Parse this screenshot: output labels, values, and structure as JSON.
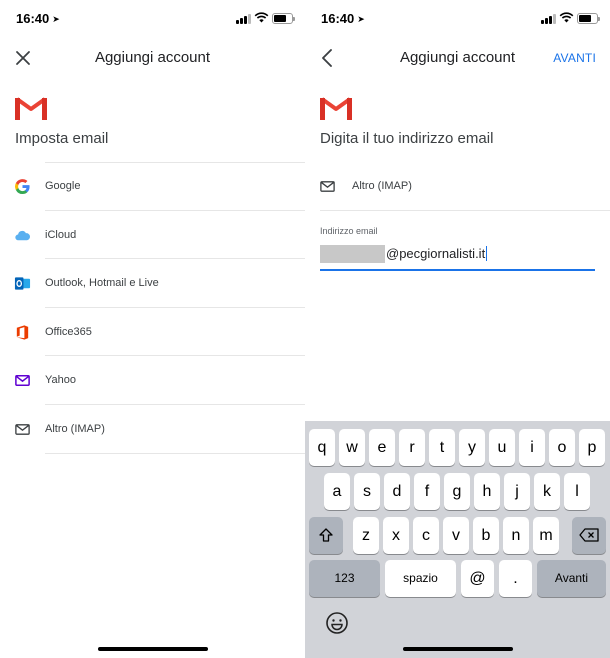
{
  "status_bar": {
    "time": "16:40"
  },
  "left": {
    "header_title": "Aggiungi account",
    "heading": "Imposta email",
    "providers": [
      {
        "label": "Google",
        "icon": "google-icon"
      },
      {
        "label": "iCloud",
        "icon": "icloud-icon"
      },
      {
        "label": "Outlook, Hotmail e Live",
        "icon": "outlook-icon"
      },
      {
        "label": "Office365",
        "icon": "office365-icon"
      },
      {
        "label": "Yahoo",
        "icon": "yahoo-icon"
      },
      {
        "label": "Altro (IMAP)",
        "icon": "mail-icon"
      }
    ]
  },
  "right": {
    "header_title": "Aggiungi account",
    "next_label": "AVANTI",
    "heading": "Digita il tuo indirizzo email",
    "selected_provider": "Altro (IMAP)",
    "field_label": "Indirizzo email",
    "field_value": "@pecgiornalisti.it"
  },
  "keyboard": {
    "row1": [
      "q",
      "w",
      "e",
      "r",
      "t",
      "y",
      "u",
      "i",
      "o",
      "p"
    ],
    "row2": [
      "a",
      "s",
      "d",
      "f",
      "g",
      "h",
      "j",
      "k",
      "l"
    ],
    "row3": [
      "z",
      "x",
      "c",
      "v",
      "b",
      "n",
      "m"
    ],
    "numbers_label": "123",
    "space_label": "spazio",
    "at_label": "@",
    "dot_label": ".",
    "return_label": "Avanti"
  },
  "colors": {
    "accent": "#1a73e8",
    "gmail_red": "#ea4335",
    "keyboard_bg": "#d1d3d8"
  }
}
